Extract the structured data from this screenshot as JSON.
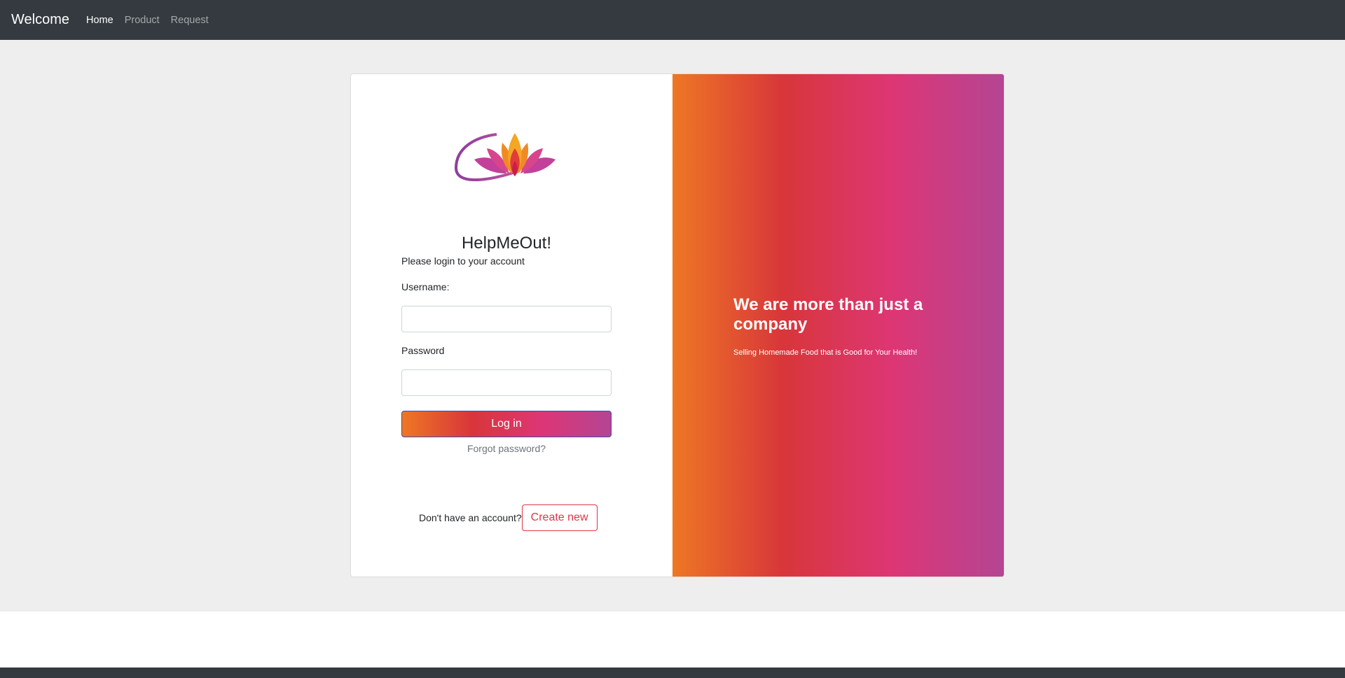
{
  "navbar": {
    "brand": "Welcome",
    "links": [
      {
        "label": "Home",
        "active": true
      },
      {
        "label": "Product",
        "active": false
      },
      {
        "label": "Request",
        "active": false
      }
    ]
  },
  "login": {
    "logo_icon": "lotus-logo-icon",
    "site_name": "HelpMeOut!",
    "intro": "Please login to your account",
    "username_label": "Username:",
    "username_value": "",
    "password_label": "Password",
    "password_value": "",
    "login_button": "Log in",
    "forgot_password": "Forgot password?",
    "no_account": "Don't have an account?",
    "create_button": "Create new"
  },
  "promo": {
    "heading": "We are more than just a company",
    "subtext": "Selling Homemade Food that is Good for Your Health!"
  },
  "colors": {
    "navbar_bg": "#343a40",
    "gradient": [
      "#ee7724",
      "#d8363a",
      "#dd3675",
      "#b44593"
    ],
    "danger": "#dc3545"
  }
}
